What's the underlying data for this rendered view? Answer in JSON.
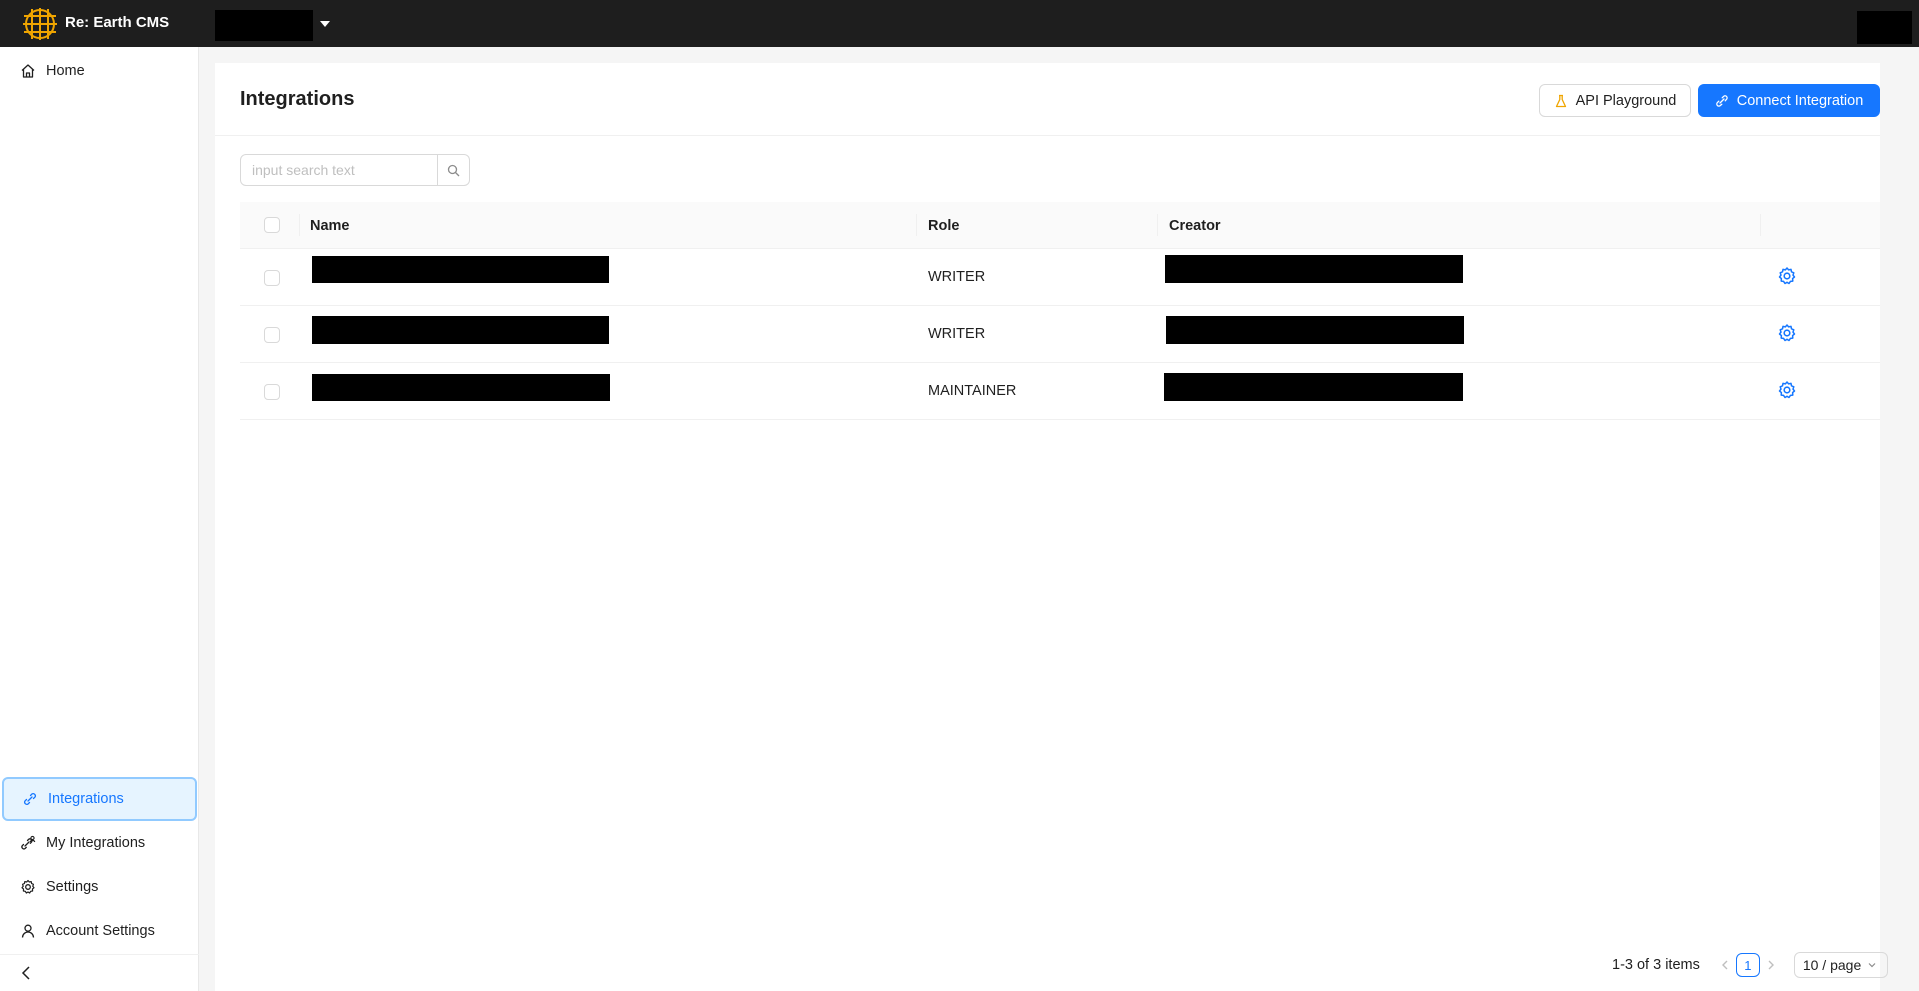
{
  "app": {
    "brand": "Re: Earth CMS"
  },
  "sidebar": {
    "top_items": [
      {
        "label": "Home",
        "icon": "home-icon"
      }
    ],
    "bottom_items": [
      {
        "label": "Integrations",
        "icon": "link-icon",
        "active": true
      },
      {
        "label": "My Integrations",
        "icon": "my-integrations-icon"
      },
      {
        "label": "Settings",
        "icon": "gear-icon"
      },
      {
        "label": "Account Settings",
        "icon": "user-icon"
      }
    ]
  },
  "page": {
    "title": "Integrations",
    "api_playground_label": "API Playground",
    "connect_label": "Connect Integration"
  },
  "search": {
    "placeholder": "input search text",
    "value": ""
  },
  "table": {
    "columns": [
      "Name",
      "Role",
      "Creator"
    ],
    "rows": [
      {
        "role": "WRITER"
      },
      {
        "role": "WRITER"
      },
      {
        "role": "MAINTAINER"
      }
    ]
  },
  "pagination": {
    "total_text": "1-3 of 3 items",
    "current_page": "1",
    "page_size": "10 / page"
  },
  "colors": {
    "accent": "#1677ff",
    "topbar": "#1e1e1e",
    "logo": "#f0a500"
  }
}
